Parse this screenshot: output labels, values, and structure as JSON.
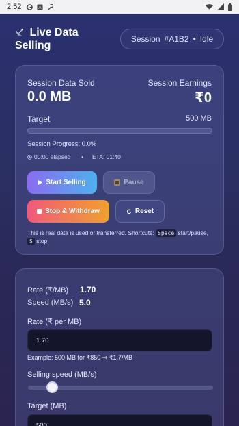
{
  "status_bar": {
    "time": "2:52",
    "icons": [
      "g-icon",
      "a-icon",
      "wrench-icon"
    ],
    "right_icons": [
      "wifi-icon",
      "signal-icon",
      "battery-icon"
    ]
  },
  "header": {
    "title": "Live Data Selling",
    "icon": "satellite-dish-icon",
    "session_label": "Session",
    "session_id": "#A1B2",
    "separator": "•",
    "session_state": "Idle"
  },
  "summary": {
    "sold_label": "Session Data Sold",
    "sold_value": "0.0 MB",
    "earnings_label": "Session Earnings",
    "earnings_value": "₹0",
    "target_label": "Target",
    "target_value": "500 MB",
    "progress_fraction": 0.0,
    "progress_text": "Session Progress: 0.0%",
    "elapsed": "00:00 elapsed",
    "dot": "•",
    "eta": "ETA: 01:40"
  },
  "actions": {
    "start_label": "Start Selling",
    "pause_label": "Pause",
    "stop_label": "Stop & Withdraw",
    "reset_label": "Reset"
  },
  "note": {
    "text": "This is real data is used or transferred. Shortcuts:",
    "key1": "Space",
    "mid": "start/pause,",
    "key2": "S",
    "end": "stop."
  },
  "settings": {
    "rate_label": "Rate (₹/MB)",
    "rate_value": "1.70",
    "speed_label": "Speed (MB/s)",
    "speed_value": "5.0",
    "rate_input_label": "Rate (₹ per MB)",
    "rate_input_value": "1.70",
    "example": "Example: 500 MB for ₹850 ⇒ ₹1.7/MB",
    "speed_slider_label": "Selling speed (MB/s)",
    "speed_slider_fraction": 0.13,
    "target_input_label": "Target (MB)",
    "target_input_value": "500"
  },
  "colors": {
    "accent_start": "#8a6cf0",
    "accent_end": "#4fb0ee",
    "stop_start": "#f05a7a",
    "stop_end": "#f0a030"
  }
}
